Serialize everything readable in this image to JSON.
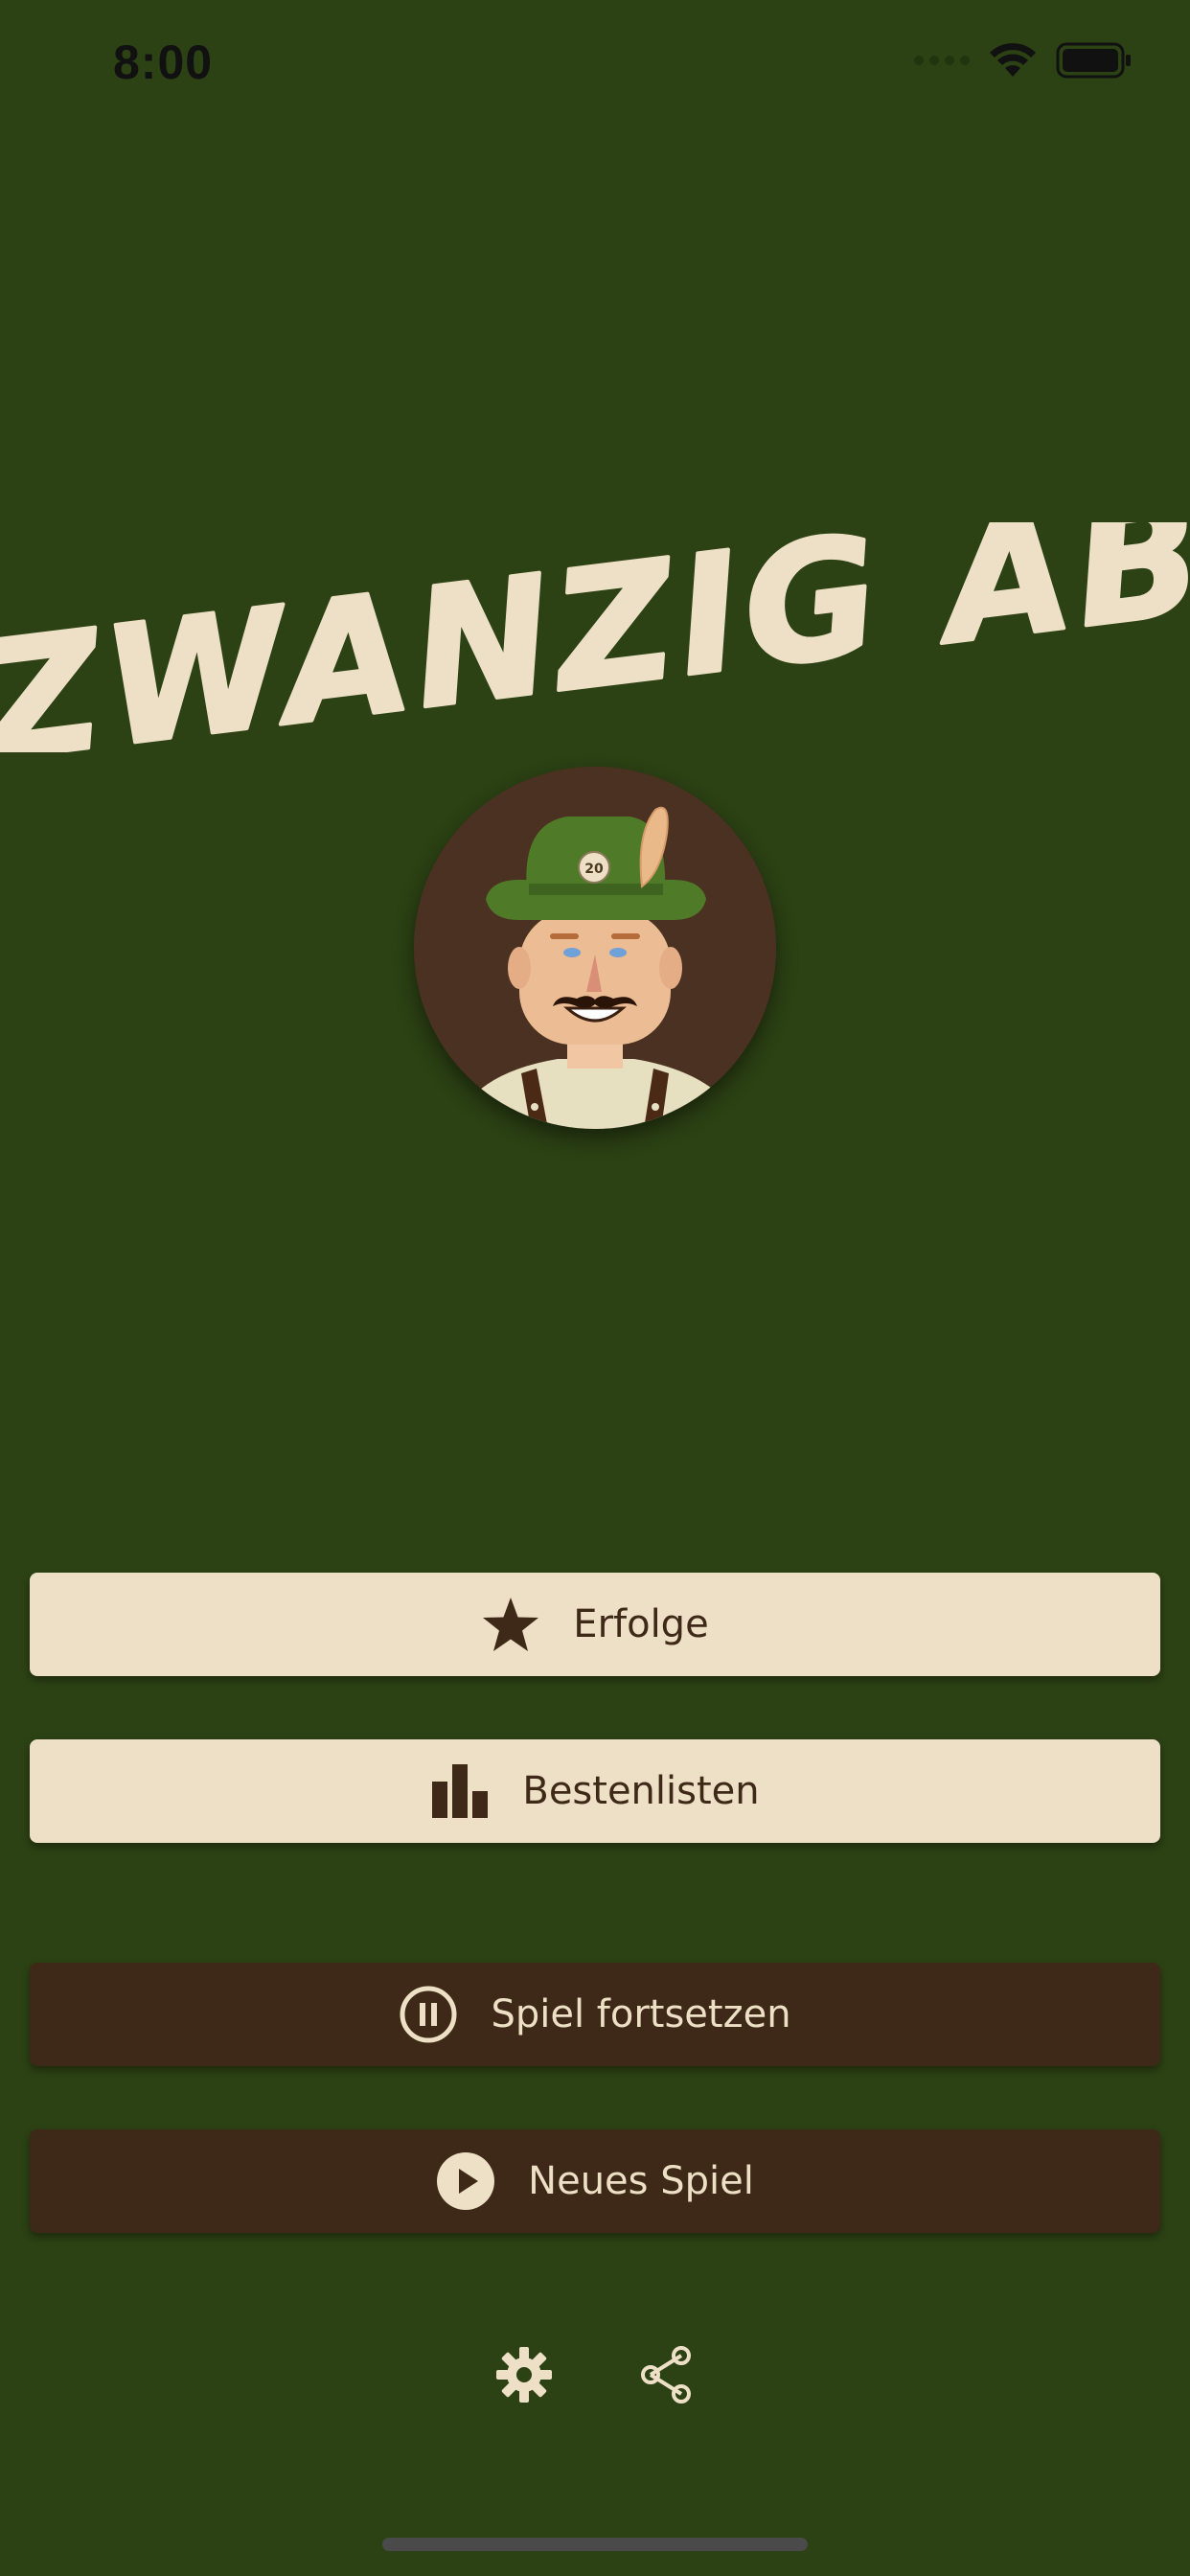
{
  "status_bar": {
    "time": "8:00"
  },
  "app": {
    "title": "Zwanzig Ab",
    "avatar_badge": "20"
  },
  "buttons": {
    "achievements": {
      "label": "Erfolge",
      "icon": "star-icon"
    },
    "leaderboards": {
      "label": "Bestenlisten",
      "icon": "bar-chart-icon"
    },
    "continue_game": {
      "label": "Spiel fortsetzen",
      "icon": "pause-icon"
    },
    "new_game": {
      "label": "Neues Spiel",
      "icon": "play-icon"
    }
  },
  "bottom_actions": [
    {
      "name": "settings",
      "icon": "gear-icon"
    },
    {
      "name": "share",
      "icon": "share-icon"
    }
  ],
  "colors": {
    "background": "#2c4114",
    "light_button": "#ede0c6",
    "dark_button": "#3e2817",
    "title_text": "#ede0c6"
  }
}
